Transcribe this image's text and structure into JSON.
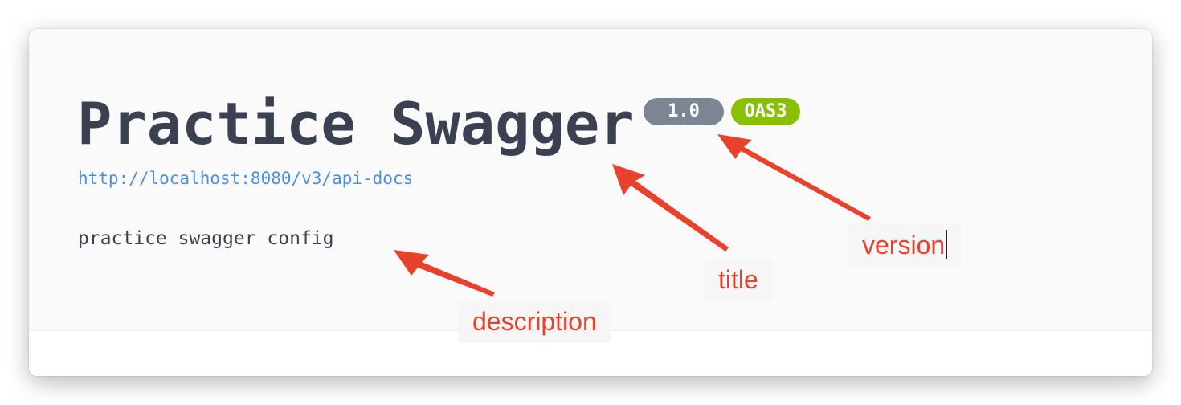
{
  "info": {
    "title": "Practice Swagger",
    "version_badge": "1.0",
    "spec_badge": "OAS3",
    "url": "http://localhost:8080/v3/api-docs",
    "description": "practice swagger config"
  },
  "annotations": {
    "version": "version",
    "title": "title",
    "description": "description"
  },
  "colors": {
    "title_text": "#3b4151",
    "version_badge": "#7d8492",
    "spec_badge": "#89bf04",
    "link": "#4990e2",
    "annotation": "#e8412c"
  }
}
